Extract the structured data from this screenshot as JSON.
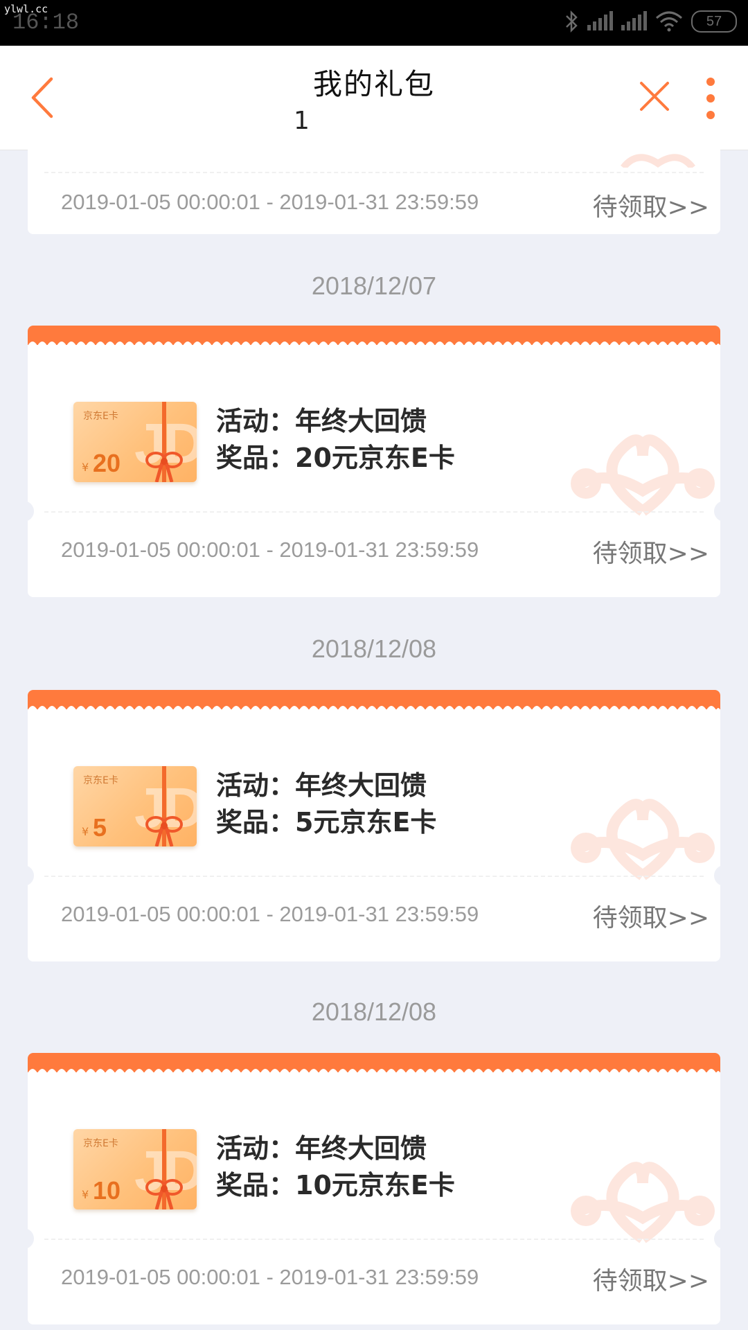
{
  "watermark": "ylwl.cc",
  "status_bar": {
    "time": "16:18",
    "battery": "57"
  },
  "header": {
    "title": "我的礼包",
    "subtitle": "1"
  },
  "partial_card": {
    "validity": "2019-01-05 00:00:01 - 2019-01-31 23:59:59",
    "action": "待领取>>"
  },
  "groups": [
    {
      "date": "2018/12/07",
      "card": {
        "brand": "京东E卡",
        "jd": "JD",
        "currency": "¥",
        "amount": "20",
        "activity": "活动：年终大回馈",
        "prize": "奖品：20元京东E卡",
        "validity": "2019-01-05 00:00:01 - 2019-01-31 23:59:59",
        "action": "待领取>>"
      }
    },
    {
      "date": "2018/12/08",
      "card": {
        "brand": "京东E卡",
        "jd": "JD",
        "currency": "¥",
        "amount": "5",
        "activity": "活动：年终大回馈",
        "prize": "奖品：5元京东E卡",
        "validity": "2019-01-05 00:00:01 - 2019-01-31 23:59:59",
        "action": "待领取>>"
      }
    },
    {
      "date": "2018/12/08",
      "card": {
        "brand": "京东E卡",
        "jd": "JD",
        "currency": "¥",
        "amount": "10",
        "activity": "活动：年终大回馈",
        "prize": "奖品：10元京东E卡",
        "validity": "2019-01-05 00:00:01 - 2019-01-31 23:59:59",
        "action": "待领取>>"
      }
    }
  ],
  "colors": {
    "accent": "#ff7a3d",
    "background": "#eef0f7",
    "card": "#ffffff"
  },
  "icons": [
    "back-arrow-icon",
    "close-icon",
    "more-vertical-icon",
    "bluetooth-icon",
    "signal-icon",
    "wifi-icon",
    "battery-icon",
    "gift-bow-icon",
    "unicom-logo-icon"
  ]
}
